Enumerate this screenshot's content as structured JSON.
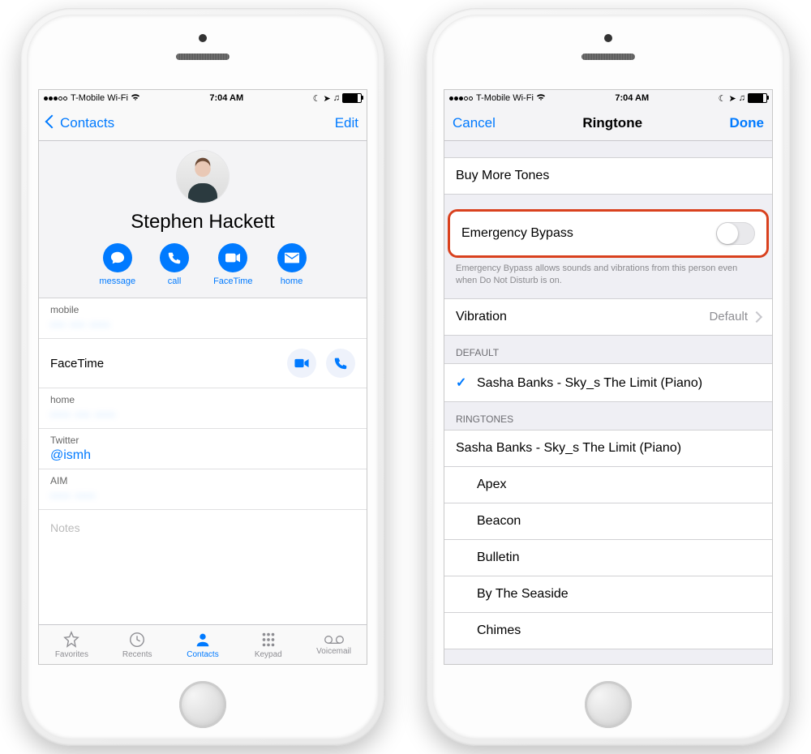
{
  "status": {
    "carrier": "T-Mobile Wi-Fi",
    "time": "7:04 AM"
  },
  "left": {
    "nav_back": "Contacts",
    "nav_edit": "Edit",
    "contact_name": "Stephen Hackett",
    "actions": {
      "message": "message",
      "call": "call",
      "facetime": "FaceTime",
      "home": "home"
    },
    "rows": {
      "mobile_label": "mobile",
      "mobile_value": "··· ··· ····",
      "facetime_label": "FaceTime",
      "home_label": "home",
      "home_value": "···· ··· ····",
      "twitter_label": "Twitter",
      "twitter_value": "@ismh",
      "aim_label": "AIM",
      "aim_value": "····  ····"
    },
    "notes_placeholder": "Notes",
    "tabs": {
      "favorites": "Favorites",
      "recents": "Recents",
      "contacts": "Contacts",
      "keypad": "Keypad",
      "voicemail": "Voicemail"
    }
  },
  "right": {
    "nav_cancel": "Cancel",
    "nav_title": "Ringtone",
    "nav_done": "Done",
    "buy_more": "Buy More Tones",
    "emergency_bypass": "Emergency Bypass",
    "emergency_bypass_footer": "Emergency Bypass allows sounds and vibrations from this person even when Do Not Disturb is on.",
    "vibration_label": "Vibration",
    "vibration_value": "Default",
    "default_header": "DEFAULT",
    "default_item": "Sasha Banks - Sky_s The Limit (Piano)",
    "ringtones_header": "RINGTONES",
    "ringtones": [
      "Sasha Banks - Sky_s The Limit (Piano)",
      "Apex",
      "Beacon",
      "Bulletin",
      "By The Seaside",
      "Chimes"
    ]
  }
}
